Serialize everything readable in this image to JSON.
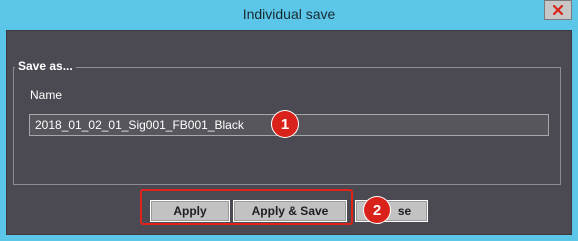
{
  "window": {
    "title": "Individual save",
    "close_icon": "close-icon"
  },
  "group": {
    "legend": "Save as..."
  },
  "name": {
    "label": "Name",
    "value": "2018_01_02_01_Sig001_FB001_Black"
  },
  "badges": {
    "one": "1",
    "two": "2"
  },
  "buttons": {
    "apply": "Apply",
    "apply_save": "Apply & Save",
    "close": "Close",
    "close_visible": "se"
  },
  "colors": {
    "titlebar": "#5bc6e8",
    "dialog_bg": "#4b4a52",
    "badge": "#d9231a",
    "highlight": "#e0231b"
  }
}
